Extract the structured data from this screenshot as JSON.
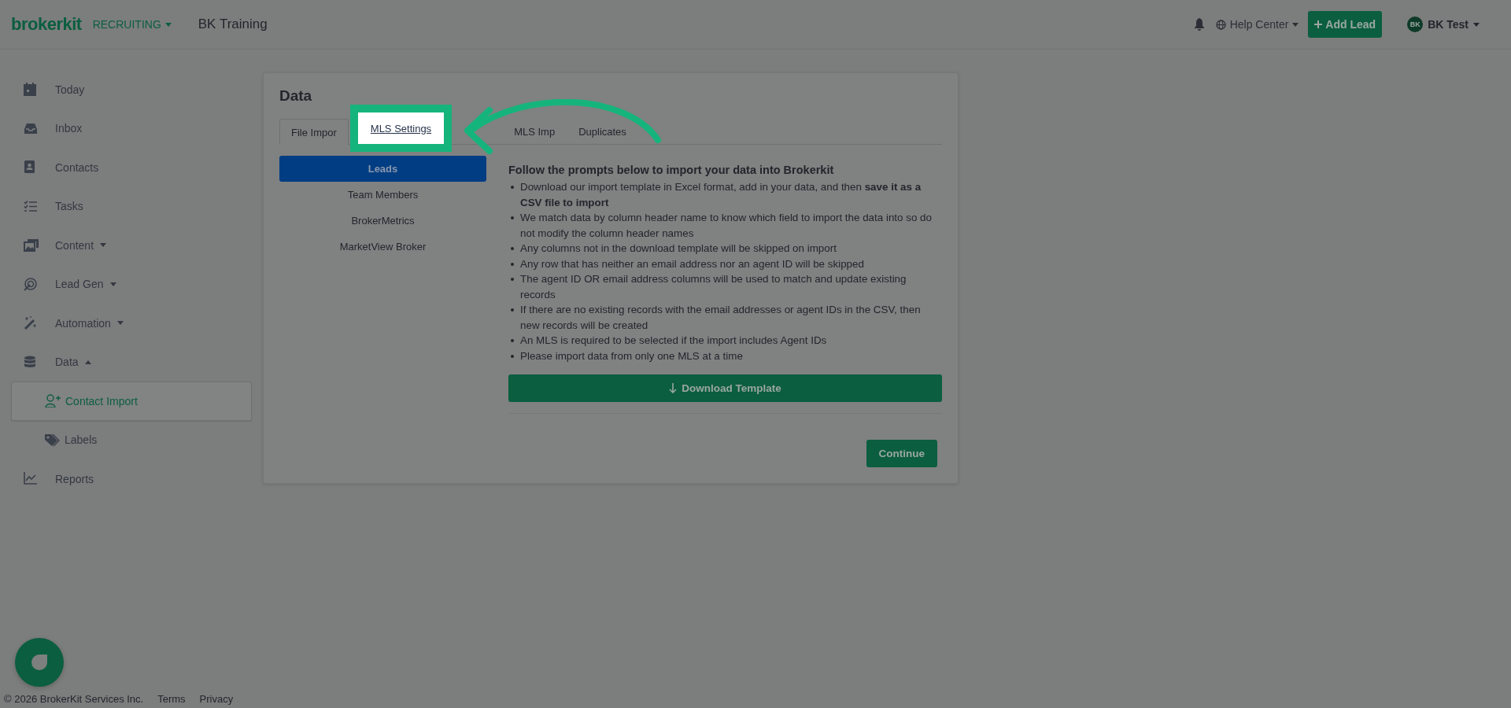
{
  "header": {
    "logo": "brokerkit",
    "module_menu": "RECRUITING",
    "org_name": "BK Training",
    "help_menu": "Help Center",
    "add_lead_button": "Add Lead",
    "user": {
      "initials": "BK",
      "name": "BK Test"
    }
  },
  "sidebar": {
    "items": [
      {
        "label": "Today",
        "selected": false
      },
      {
        "label": "Inbox",
        "selected": false
      },
      {
        "label": "Contacts",
        "selected": false
      },
      {
        "label": "Tasks",
        "selected": false
      },
      {
        "label": "Content",
        "selected": false,
        "expanded": false
      },
      {
        "label": "Lead Gen",
        "selected": false,
        "expanded": false
      },
      {
        "label": "Automation",
        "selected": false,
        "expanded": false
      },
      {
        "label": "Data",
        "selected": false,
        "expanded": true,
        "children": [
          {
            "label": "Contact Import",
            "selected": true
          },
          {
            "label": "Labels",
            "selected": false
          }
        ]
      },
      {
        "label": "Reports",
        "selected": false
      }
    ]
  },
  "card": {
    "title": "Data",
    "tabs": [
      {
        "label": "File Impor",
        "selected": true,
        "spotlight": false
      },
      {
        "label": "MLS Settings",
        "selected": false,
        "spotlight": true
      },
      {
        "label": "MLS Imp",
        "selected": false,
        "spotlight": false
      },
      {
        "label": "Duplicates",
        "selected": false,
        "spotlight": false
      }
    ],
    "import_types": [
      {
        "label": "Leads",
        "selected": true
      },
      {
        "label": "Team Members",
        "selected": false
      },
      {
        "label": "BrokerMetrics",
        "selected": false
      },
      {
        "label": "MarketView Broker",
        "selected": false
      }
    ],
    "instructions": {
      "heading": "Follow the prompts below to import your data into Brokerkit",
      "bullets": [
        "Download our import template in Excel format, add in your data, and then **save it as a CSV file to import**",
        "We match data by column header name to know which field to import the data into so do not modify the column header names",
        "Any columns not in the download template will be skipped on import",
        "Any row that has neither an email address nor an agent ID will be skipped",
        "The agent ID OR email address columns will be used to match and update existing records",
        "If there are no existing records with the email addresses or agent IDs in the CSV, then new records will be created",
        "An MLS is required to be selected if the import includes Agent IDs",
        "Please import data from only one MLS at a time"
      ]
    },
    "download_button": "Download Template",
    "continue_button": "Continue"
  },
  "footer": {
    "copyright": "© 2026 BrokerKit Services Inc.",
    "links": [
      "Terms",
      "Privacy"
    ]
  }
}
